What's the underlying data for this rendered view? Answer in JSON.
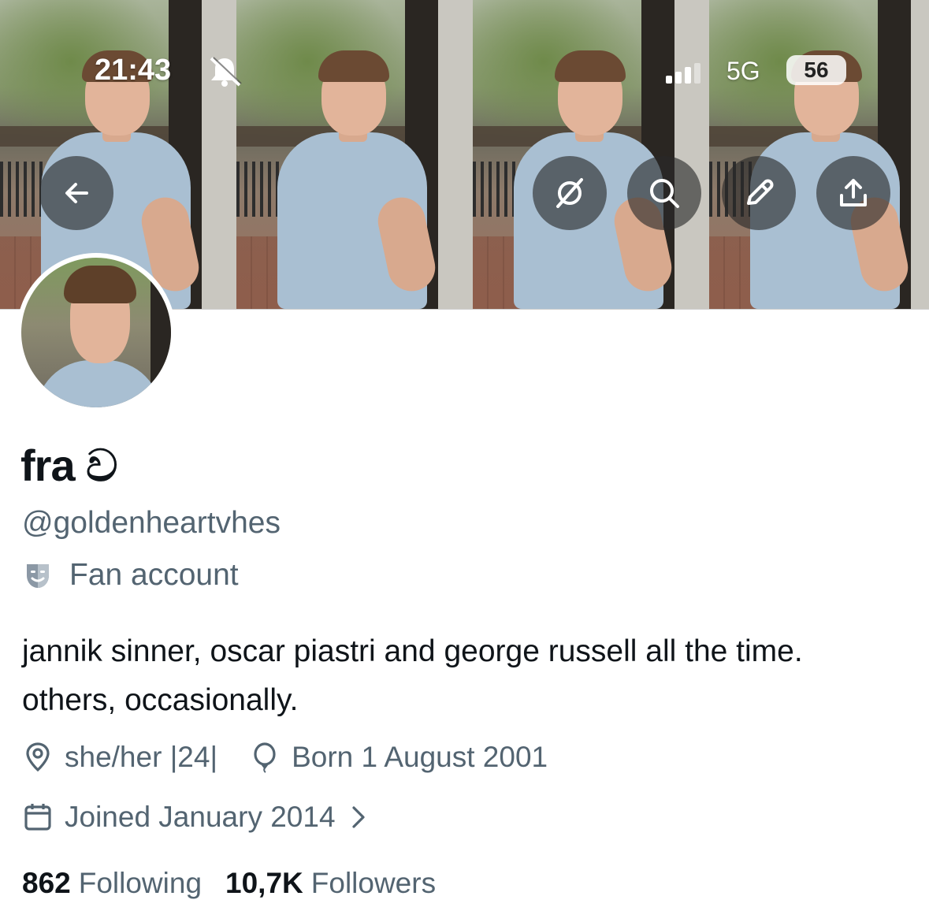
{
  "status_bar": {
    "time": "21:43",
    "network": "5G",
    "battery": "56"
  },
  "header_actions": {
    "back": "back-arrow-icon",
    "grok": "grok-icon",
    "search": "search-icon",
    "edit": "edit-pencil-icon",
    "share": "share-icon"
  },
  "profile": {
    "display_name": "fra ව",
    "handle": "@goldenheartvhes",
    "category": "Fan account",
    "bio": "jannik sinner, oscar piastri and george russell all the time. others, occasionally.",
    "location": "she/her |24|",
    "birthday": "Born 1 August 2001",
    "joined": "Joined January 2014",
    "following_count": "862",
    "following_label": "Following",
    "followers_count": "10,7K",
    "followers_label": "Followers"
  },
  "colors": {
    "text_primary": "#0f1419",
    "text_secondary": "#536471",
    "button_bg": "rgba(40,40,40,0.62)"
  }
}
